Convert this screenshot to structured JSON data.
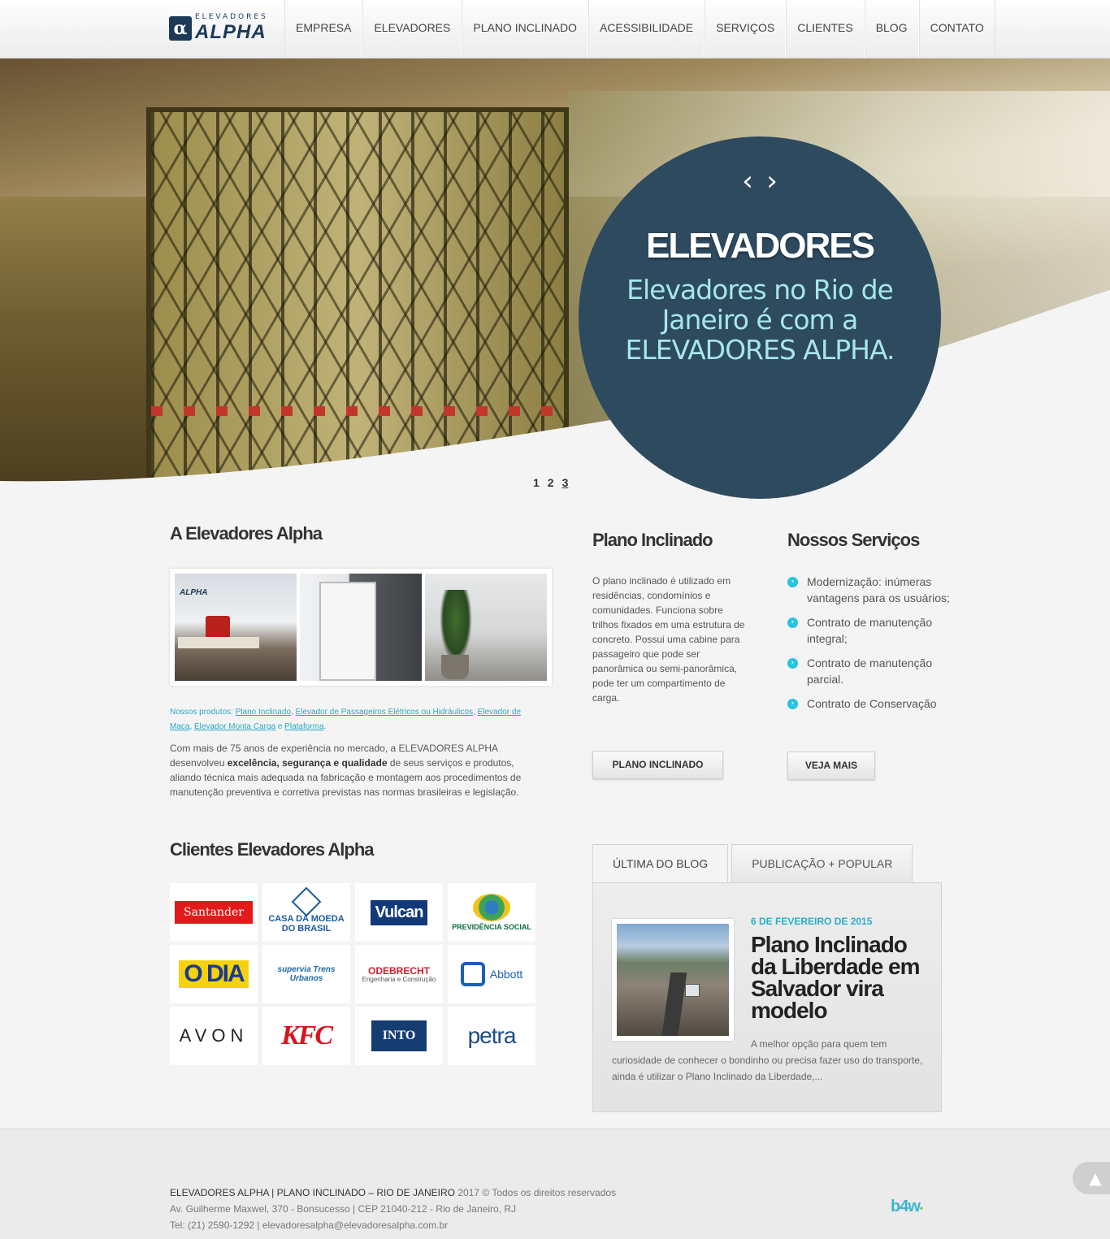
{
  "header": {
    "logo_small": "ELEVADORES",
    "logo_big": "ALPHA",
    "nav": [
      "EMPRESA",
      "ELEVADORES",
      "PLANO INCLINADO",
      "ACESSIBILIDADE",
      "SERVIÇOS",
      "CLIENTES",
      "BLOG",
      "CONTATO"
    ]
  },
  "hero": {
    "prev": "‹",
    "next": "›",
    "title": "ELEVADORES",
    "subtitle": "Elevadores no Rio de Janeiro é com a ELEVADORES ALPHA.",
    "pages": [
      "1",
      "2",
      "3"
    ],
    "circle_color": "#2d4a5f"
  },
  "about": {
    "title": "A Elevadores Alpha",
    "gallery_logo": "ALPHA",
    "products_prefix": "Nossos produtos:",
    "products": [
      "Plano Inclinado",
      "Elevador de Passageiros Elétricos ou Hidráulicos",
      "Elevador de Maca",
      "Elevador Monta Carga",
      "Plataforma"
    ],
    "products_and": "e",
    "text_1": "Com mais de 75 anos de experiência no mercado, a ELEVADORES ALPHA desenvolveu",
    "text_bold": "excelência, segurança e qualidade",
    "text_2": "de seus serviços e produtos, aliando técnica mais adequada na fabricação e montagem aos procedimentos de manutenção preventiva e corretiva previstas nas normas brasileiras e legislação."
  },
  "plano": {
    "title": "Plano Inclinado",
    "text": "O plano inclinado é utilizado em residências, condomínios e comunidades. Funciona sobre trilhos fixados em uma estrutura de concreto. Possui uma cabine para passageiro que pode ser panorâmica ou semi-panorâmica, pode ter um compartimento de carga.",
    "button": "PLANO INCLINADO"
  },
  "servicos": {
    "title": "Nossos Serviços",
    "items": [
      "Modernização: inúmeras vantagens para os usuários;",
      "Contrato de manutenção integral;",
      "Contrato de manutenção parcial.",
      "Contrato de Conservação"
    ],
    "bullet": "›",
    "button": "VEJA MAIS",
    "accent": "#27c3e0"
  },
  "clientes": {
    "title": "Clientes Elevadores Alpha",
    "logos": {
      "santander": "Santander",
      "moeda": "CASA DA MOEDA DO BRASIL",
      "vulcan": "Vulcan",
      "previdencia": "PREVIDÊNCIA SOCIAL",
      "odia": "O DIA",
      "supervia": "supervia Trens Urbanos",
      "odebrecht": "ODEBRECHT",
      "odebrecht_sub": "Engenharia e Construção",
      "abbott": "Abbott",
      "avon": "AVON",
      "kfc": "KFC",
      "into": "INTO",
      "petra": "petra"
    }
  },
  "blog": {
    "tabs": [
      "ÚLTIMA DO BLOG",
      "PUBLICAÇÃO + POPULAR"
    ],
    "date": "6 DE FEVEREIRO DE 2015",
    "title": "Plano Inclinado da Liberdade em Salvador vira modelo",
    "excerpt": "A melhor opção para quem tem curiosidade de conhecer o bondinho ou precisa fazer uso do transporte, ainda é utilizar o Plano Inclinado da Liberdade,..."
  },
  "footer": {
    "line1_strong": "ELEVADORES ALPHA | PLANO INCLINADO – RIO DE JANEIRO",
    "line1_rest": "2017 © Todos os direitos reservados",
    "line2": "Av. Guilherme Maxwel, 370 - Bonsucesso | CEP 21040-212 - Rio de Janeiro, RJ",
    "line3": "Tel: (21) 2590-1292 | elevadoresalpha@elevadoresalpha.com.br",
    "credit": "b4w",
    "to_top": "▲"
  }
}
